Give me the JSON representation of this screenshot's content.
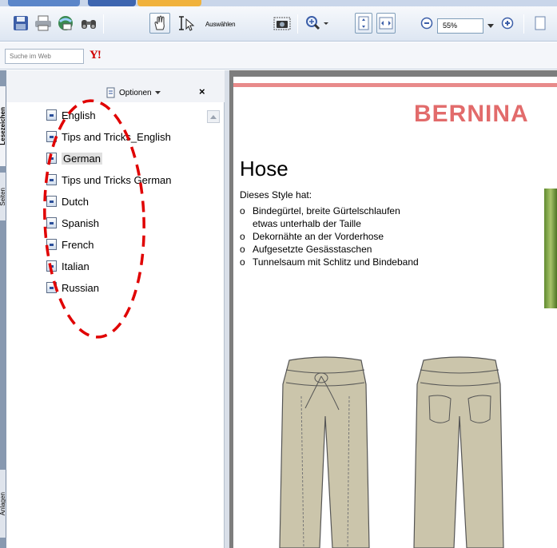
{
  "toolbar": {
    "select_tool_label": "Auswählen",
    "zoom_value": "55%"
  },
  "search": {
    "placeholder": "Suche im Web",
    "provider_logo": "Y!"
  },
  "side_tabs": {
    "bookmarks": "Lesezeichen",
    "pages": "Seiten",
    "attachments": "Anlagen"
  },
  "bookmarks_panel": {
    "options_label": "Optionen",
    "close_glyph": "×",
    "items": [
      {
        "label": "English"
      },
      {
        "label": "Tips and Tricks_English"
      },
      {
        "label": "German"
      },
      {
        "label": "Tips und Tricks German"
      },
      {
        "label": "Dutch"
      },
      {
        "label": "Spanish"
      },
      {
        "label": "French"
      },
      {
        "label": "Italian"
      },
      {
        "label": "Russian"
      }
    ],
    "selected_index": 2
  },
  "document": {
    "brand": "BERNINA",
    "title": "Hose",
    "intro": "Dieses Style hat:",
    "features": [
      "Bindegürtel, breite Gürtelschlaufen",
      "etwas unterhalb der Taille",
      "Dekornähte an der Vorderhose",
      "Aufgesetzte Gesässtaschen",
      "Tunnelsaum mit Schlitz und Bindeband"
    ],
    "bullets": [
      "o",
      "",
      "o",
      "o",
      "o"
    ]
  },
  "colors": {
    "brand": "#e26b6b",
    "annotation": "#e00000",
    "pants_fill": "#cbc5ab"
  },
  "icons": [
    "save-icon",
    "print-icon",
    "email-icon",
    "find-icon",
    "hand-tool-icon",
    "select-text-icon",
    "snapshot-icon",
    "zoom-in-icon",
    "fit-page-icon",
    "fit-width-icon",
    "zoom-out-icon",
    "zoom-plus-icon",
    "options-icon",
    "bookmark-page-icon"
  ]
}
